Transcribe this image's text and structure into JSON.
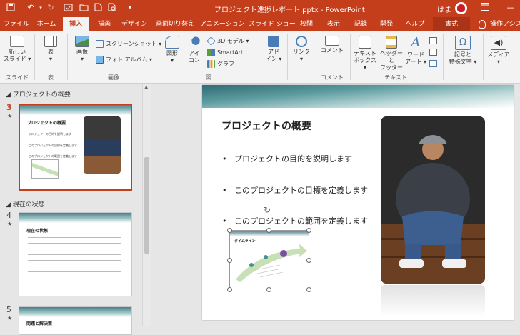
{
  "titlebar": {
    "title": "プロジェクト進捗レポート.pptx  -  PowerPoint",
    "user": "はま",
    "icons": [
      "save-icon",
      "undo-icon",
      "redo-icon",
      "autosave-icon",
      "open-icon",
      "new-icon",
      "print-preview-icon",
      "customize-qat-icon",
      "ribbon-display-icon",
      "minimize-icon"
    ]
  },
  "tabs": [
    {
      "label": "ファイル"
    },
    {
      "label": "ホーム"
    },
    {
      "label": "挿入"
    },
    {
      "label": "描画"
    },
    {
      "label": "デザイン"
    },
    {
      "label": "画面切り替え"
    },
    {
      "label": "アニメーション"
    },
    {
      "label": "スライド ショー"
    },
    {
      "label": "校閲"
    },
    {
      "label": "表示"
    },
    {
      "label": "記録"
    },
    {
      "label": "開発"
    },
    {
      "label": "ヘルプ"
    },
    {
      "label": "書式"
    },
    {
      "label": "操作アシス"
    }
  ],
  "ribbon": {
    "new_slide": "新しい\nスライド ▾",
    "table": "表\n▾",
    "image": "画像\n▾",
    "screenshot": "スクリーンショット ▾",
    "photo_album": "フォト アルバム ▾",
    "shapes": "図形\n▾",
    "icons": "アイ\nコン",
    "model3d": "3D モデル ▾",
    "smartart": "SmartArt",
    "graph": "グラフ",
    "addin": "アド\nイン ▾",
    "link": "リンク\n▾",
    "comment": "コメント",
    "textbox": "テキスト\nボックス ▾",
    "header_footer": "ヘッダーと\nフッター",
    "wordart": "ワード\nアート ▾",
    "symbol": "記号と\n特殊文字 ▾",
    "media": "メディア\n▾",
    "groups": {
      "slide": "スライド",
      "table": "表",
      "image": "画像",
      "figure": "図",
      "comment": "コメント",
      "text": "テキスト"
    }
  },
  "thumbnails": {
    "sections": [
      {
        "name": "プロジェクトの概要"
      },
      {
        "name": "現在の状態"
      }
    ],
    "slides": [
      {
        "num": "3",
        "title": "プロジェクトの概要",
        "bullets": [
          "プロジェクトの目的を説明します",
          "このプロジェクトの目標を定義します",
          "このプロジェクトの範囲を定義します"
        ]
      },
      {
        "num": "4",
        "title": "現在の状態"
      },
      {
        "num": "5",
        "title": "問題と解決策"
      }
    ]
  },
  "slide": {
    "title": "プロジェクトの概要",
    "bullets": [
      "プロジェクトの目的を説明します",
      "このプロジェクトの目標を定義します",
      "このプロジェクトの範囲を定義します"
    ],
    "timeline_label": "タイムライン"
  },
  "colors": {
    "accent": "#c43e1c",
    "teal": "#4a8f91",
    "green": "#7db85b",
    "purple": "#7a4fa3"
  }
}
